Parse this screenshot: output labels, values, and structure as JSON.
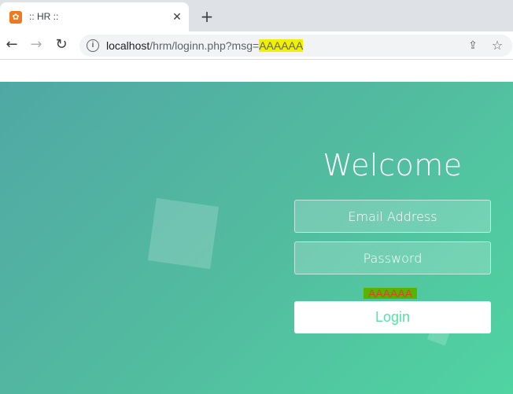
{
  "browser": {
    "tab": {
      "favicon": "xampp-icon",
      "title": ":: HR ::"
    },
    "new_tab_label": "+",
    "url": {
      "host": "localhost",
      "path": "/hrm/loginn.php?msg=",
      "highlight": "AAAAAA"
    }
  },
  "login": {
    "heading": "Welcome",
    "email_placeholder": "Email Address",
    "password_placeholder": "Password",
    "message": "AAAAAA",
    "login_label": "Login"
  },
  "colors": {
    "gradient_start": "#50a8a5",
    "gradient_end": "#50d4a2",
    "login_text": "#53e3a6",
    "url_highlight": "#f0f000",
    "message_bg": "#58b400",
    "message_text": "#e04030"
  }
}
